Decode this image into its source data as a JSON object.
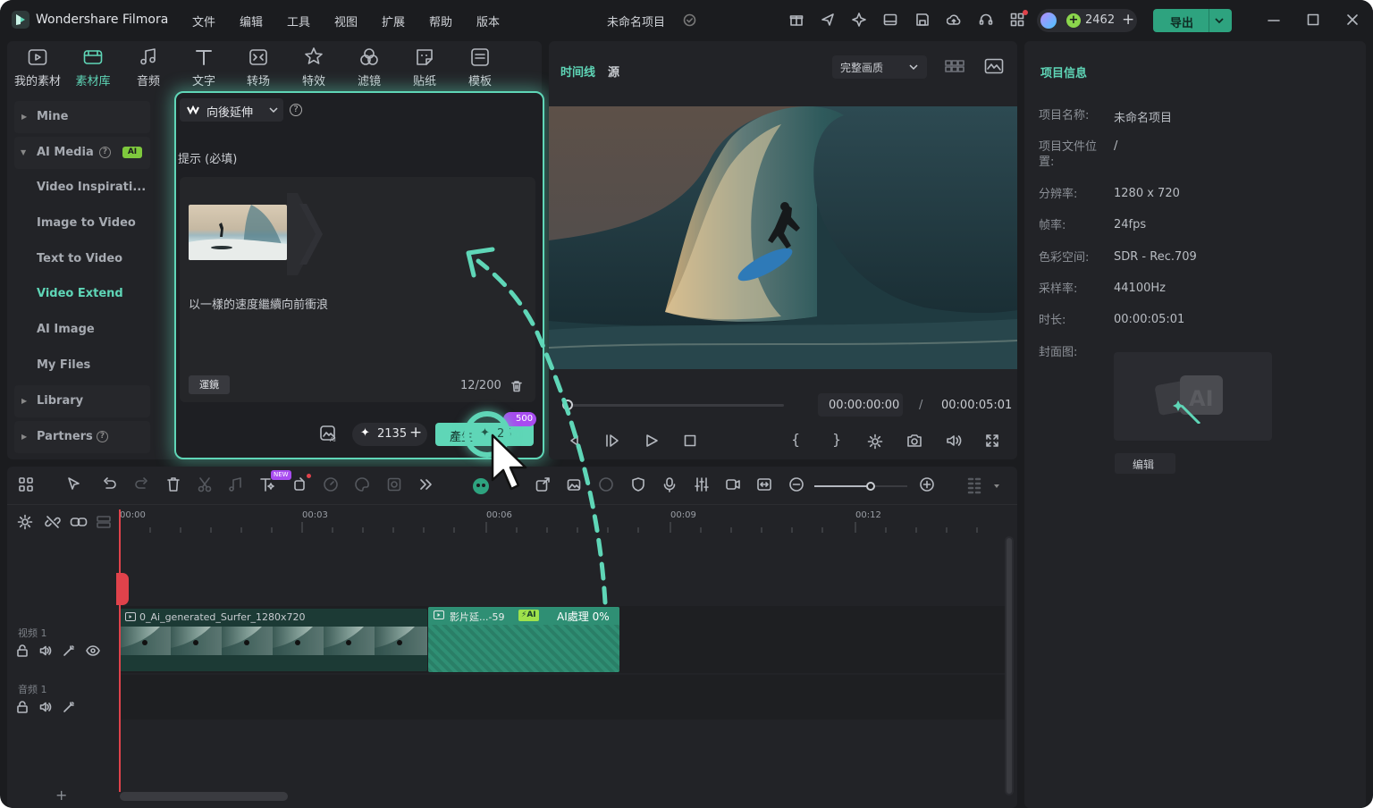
{
  "app": {
    "name": "Wondershare Filmora",
    "project_title": "未命名项目",
    "credits": "2462",
    "export_label": "导出"
  },
  "menu": [
    "文件",
    "编辑",
    "工具",
    "视图",
    "扩展",
    "帮助",
    "版本"
  ],
  "media_tabs": [
    {
      "label": "我的素材",
      "icon": "folder-icon"
    },
    {
      "label": "素材库",
      "icon": "stock-library-icon"
    },
    {
      "label": "音频",
      "icon": "music-note-icon"
    },
    {
      "label": "文字",
      "icon": "text-icon"
    },
    {
      "label": "转场",
      "icon": "transition-icon"
    },
    {
      "label": "特效",
      "icon": "effects-icon"
    },
    {
      "label": "滤镜",
      "icon": "filter-icon"
    },
    {
      "label": "贴纸",
      "icon": "sticker-icon"
    },
    {
      "label": "模板",
      "icon": "template-icon"
    }
  ],
  "sidebar": {
    "mine": "Mine",
    "ai_media": "AI Media",
    "ai_badge": "AI",
    "items": [
      "Video Inspirati...",
      "Image to Video",
      "Text to Video",
      "Video Extend",
      "AI Image",
      "My Files"
    ],
    "library": "Library",
    "partners": "Partners"
  },
  "extend_panel": {
    "mode_label": "向後延伸",
    "prompt_label": "提示 (必填)",
    "prompt_text": "以一樣的速度繼續向前衝浪",
    "camera_tag": "運鏡",
    "char_count": "12/200",
    "credits": "2135",
    "generate_label": "產生",
    "generate_cost": "25",
    "bonus_badge": "500"
  },
  "preview": {
    "tab_timeline": "时间线",
    "tab_source": "源",
    "quality": "完整画质",
    "current_time": "00:00:00:00",
    "separator": "/",
    "total_time": "00:00:05:01"
  },
  "project_info": {
    "title": "项目信息",
    "rows": [
      {
        "label": "项目名称:",
        "value": "未命名项目"
      },
      {
        "label": "项目文件位置:",
        "value": "/"
      },
      {
        "label": "分辨率:",
        "value": "1280 x 720"
      },
      {
        "label": "帧率:",
        "value": "24fps"
      },
      {
        "label": "色彩空间:",
        "value": "SDR - Rec.709"
      },
      {
        "label": "采样率:",
        "value": "44100Hz"
      },
      {
        "label": "时长:",
        "value": "00:00:05:01"
      },
      {
        "label": "封面图:",
        "value": ""
      }
    ],
    "cover_badge": "AI",
    "edit_label": "编辑"
  },
  "timeline": {
    "ruler": [
      "00:00",
      "00:03",
      "00:06",
      "00:09",
      "00:12"
    ],
    "video_track": "视频 1",
    "audio_track": "音频 1",
    "clip1_name": "0_Ai_generated_Surfer_1280x720",
    "clip2_name": "影片延...-59",
    "clip2_ai_badge": "AI",
    "clip2_status": "AI處理 0%",
    "new_badge": "NEW"
  },
  "colors": {
    "accent": "#5fd6b7",
    "bg": "#1b1c1f",
    "panel": "#222327",
    "clip1": "#1c3a35",
    "clip2": "#2f8f74",
    "playhead": "#e0424b"
  }
}
